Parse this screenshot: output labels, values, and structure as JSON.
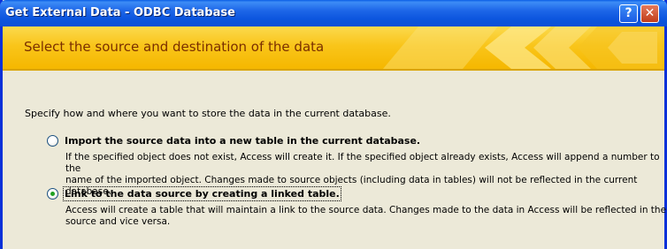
{
  "window": {
    "title": "Get External Data - ODBC Database",
    "help_button": "?",
    "close_button": "✕"
  },
  "banner": {
    "title": "Select the source and destination of the data"
  },
  "main": {
    "instructions": "Specify how and where you want to store the data in the current database.",
    "options": [
      {
        "label": "Import the source data into a new table in the current database.",
        "description_line1": "If the specified object does not exist, Access will create it. If the specified object already exists, Access will append a number to the",
        "description_line2": "name of the imported object. Changes made to source objects (including data in tables) will not be reflected in the current database.",
        "selected": false
      },
      {
        "label": "Link to the data source by creating a linked table.",
        "description_line1": "Access will create a table that will maintain a link to the source data. Changes made to the data in Access will be reflected in the",
        "description_line2": "source and vice versa.",
        "selected": true
      }
    ]
  },
  "colors": {
    "titlebar": "#0a5ee6",
    "banner": "#f9c51a",
    "banner_text": "#7a2f00",
    "background": "#ece9d8",
    "radio_selected": "#21a121"
  }
}
